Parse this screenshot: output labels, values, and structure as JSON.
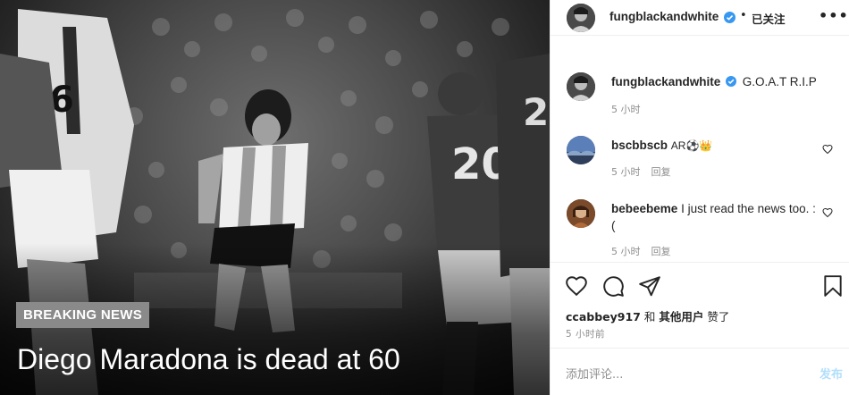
{
  "photo": {
    "badge": "BREAKING NEWS",
    "headline": "Diego Maradona is dead at 60",
    "jersey_numbers": [
      "6",
      "20",
      "2"
    ]
  },
  "header": {
    "username": "fungblackandwhite",
    "separator": "•",
    "follow_label": "已关注",
    "more_label": "•••"
  },
  "caption": {
    "username": "fungblackandwhite",
    "text": "G.O.A.T R.I.P",
    "time": "5 小时"
  },
  "comments": [
    {
      "username": "bscbbscb",
      "text": "AR⚽👑",
      "time": "5 小时",
      "reply_label": "回复"
    },
    {
      "username": "bebeebeme",
      "text": "I just read the news too. :(",
      "time": "5 小时",
      "reply_label": "回复"
    }
  ],
  "likes": {
    "user": "ccabbey917",
    "joiner": "和",
    "others": "其他用户",
    "suffix": "赞了"
  },
  "post_time": "5 小时前",
  "add_comment": {
    "placeholder": "添加评论...",
    "post_label": "发布"
  },
  "colors": {
    "verified": "#3897f0",
    "post_disabled": "#b2dffc",
    "meta_gray": "#8e8e8e",
    "badge_bg": "#8a8a8a"
  },
  "icons": [
    "verified-badge-icon",
    "more-options-icon",
    "heart-icon",
    "comment-icon",
    "share-icon",
    "bookmark-icon"
  ]
}
